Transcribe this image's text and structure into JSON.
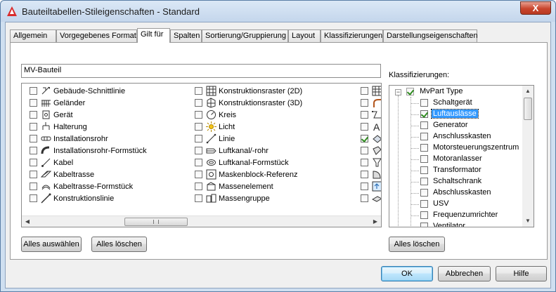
{
  "window": {
    "title": "Bauteiltabellen-Stileigenschaften - Standard",
    "close_glyph": "X"
  },
  "tabs": [
    {
      "label": "Allgemein",
      "active": false
    },
    {
      "label": "Vorgegebenes Format",
      "active": false
    },
    {
      "label": "Gilt für",
      "active": true
    },
    {
      "label": "Spalten",
      "active": false
    },
    {
      "label": "Sortierung/Gruppierung",
      "active": false
    },
    {
      "label": "Layout",
      "active": false
    },
    {
      "label": "Klassifizierungen",
      "active": false
    },
    {
      "label": "Darstellungseigenschaften",
      "active": false
    }
  ],
  "applies_to": {
    "name_value": "MV-Bauteil",
    "column1": [
      {
        "label": "Gebäude-Schnittlinie",
        "icon": "section-line-icon",
        "checked": false
      },
      {
        "label": "Geländer",
        "icon": "railing-icon",
        "checked": false
      },
      {
        "label": "Gerät",
        "icon": "device-icon",
        "checked": false
      },
      {
        "label": "Halterung",
        "icon": "hanger-icon",
        "checked": false
      },
      {
        "label": "Installationsrohr",
        "icon": "conduit-icon",
        "checked": false
      },
      {
        "label": "Installationsrohr-Formstück",
        "icon": "conduit-fitting-icon",
        "checked": false
      },
      {
        "label": "Kabel",
        "icon": "wire-icon",
        "checked": false
      },
      {
        "label": "Kabeltrasse",
        "icon": "cable-tray-icon",
        "checked": false
      },
      {
        "label": "Kabeltrasse-Formstück",
        "icon": "cable-tray-fitting-icon",
        "checked": false
      },
      {
        "label": "Konstruktionslinie",
        "icon": "construction-line-icon",
        "checked": false
      }
    ],
    "column2": [
      {
        "label": "Konstruktionsraster (2D)",
        "icon": "grid-2d-icon",
        "checked": false
      },
      {
        "label": "Konstruktionsraster (3D)",
        "icon": "grid-3d-icon",
        "checked": false
      },
      {
        "label": "Kreis",
        "icon": "circle-icon",
        "checked": false
      },
      {
        "label": "Licht",
        "icon": "light-icon",
        "checked": false
      },
      {
        "label": "Linie",
        "icon": "line-icon",
        "checked": false
      },
      {
        "label": "Luftkanal/-rohr",
        "icon": "duct-icon",
        "checked": false
      },
      {
        "label": "Luftkanal-Formstück",
        "icon": "duct-fitting-icon",
        "checked": false
      },
      {
        "label": "Maskenblock-Referenz",
        "icon": "mask-block-icon",
        "checked": false
      },
      {
        "label": "Massenelement",
        "icon": "mass-element-icon",
        "checked": false
      },
      {
        "label": "Massengruppe",
        "icon": "mass-group-icon",
        "checked": false
      }
    ],
    "column3": [
      {
        "label": "",
        "icon": "table-icon",
        "checked": false
      },
      {
        "label": "",
        "icon": "pipe-bend-icon",
        "checked": false
      },
      {
        "label": "",
        "icon": "polyline-icon",
        "checked": false
      },
      {
        "label": "",
        "icon": "text-icon",
        "glyph": "A",
        "checked": false
      },
      {
        "label": "",
        "icon": "mvpart-icon",
        "checked": true
      },
      {
        "label": "",
        "icon": "face-icon",
        "checked": false
      },
      {
        "label": "",
        "icon": "funnel-icon",
        "checked": false
      },
      {
        "label": "",
        "icon": "area-icon",
        "checked": false
      },
      {
        "label": "",
        "icon": "door-icon",
        "checked": false
      },
      {
        "label": "",
        "icon": "slab-icon",
        "checked": false
      }
    ],
    "select_all_label": "Alles auswählen",
    "clear_all_label": "Alles löschen"
  },
  "classifications": {
    "label": "Klassifizierungen:",
    "root": {
      "label": "MvPart Type",
      "checked": true,
      "expander": "−"
    },
    "items": [
      {
        "label": "Schaltgerät",
        "checked": false,
        "selected": false
      },
      {
        "label": "Luftauslässe",
        "checked": true,
        "selected": true
      },
      {
        "label": "Generator",
        "checked": false,
        "selected": false
      },
      {
        "label": "Anschlusskasten",
        "checked": false,
        "selected": false
      },
      {
        "label": "Motorsteuerungszentrum",
        "checked": false,
        "selected": false
      },
      {
        "label": "Motoranlasser",
        "checked": false,
        "selected": false
      },
      {
        "label": "Transformator",
        "checked": false,
        "selected": false
      },
      {
        "label": "Schaltschrank",
        "checked": false,
        "selected": false
      },
      {
        "label": "Abschlusskasten",
        "checked": false,
        "selected": false
      },
      {
        "label": "USV",
        "checked": false,
        "selected": false
      },
      {
        "label": "Frequenzumrichter",
        "checked": false,
        "selected": false
      },
      {
        "label": "Ventilator",
        "checked": false,
        "selected": false
      }
    ],
    "clear_all_label": "Alles löschen"
  },
  "footer": {
    "ok_label": "OK",
    "cancel_label": "Abbrechen",
    "help_label": "Hilfe"
  },
  "colors": {
    "accent": "#3399ff",
    "check": "#2e8b1f",
    "app_icon": "#d92b2b"
  }
}
